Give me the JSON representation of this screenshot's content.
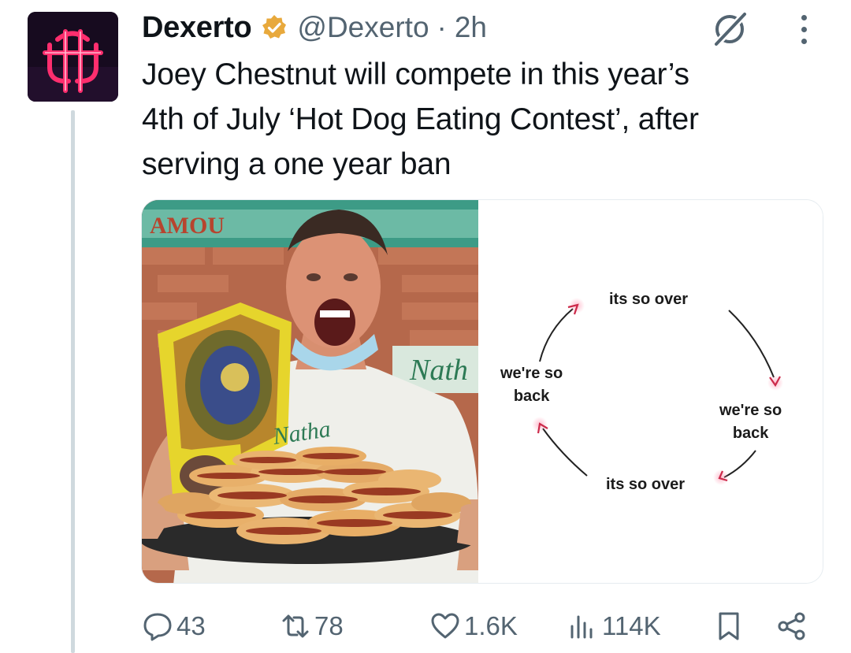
{
  "tweet": {
    "author_name": "Dexerto",
    "handle": "@Dexerto",
    "separator": "·",
    "time": "2h",
    "text_lines": [
      "Joey Chestnut will compete in this year’s",
      "4th of July ‘Hot Dog Eating Contest’, after",
      "serving a one year ban"
    ]
  },
  "meme": {
    "top": "its so over",
    "right_line1": "we're so",
    "right_line2": "back",
    "bottom": "its so over",
    "left_line1": "we're so",
    "left_line2": "back"
  },
  "actions": {
    "replies": "43",
    "reposts": "78",
    "likes": "1.6K",
    "views": "114K"
  },
  "colors": {
    "text": "#0f1419",
    "secondary": "#536471",
    "verified_badge": "#e8a93c",
    "thread_line": "#cfd9de",
    "avatar_neon": "#ff2e6e"
  },
  "icons": [
    "verified-badge-icon",
    "grok-icon",
    "more-icon",
    "reply-icon",
    "repost-icon",
    "like-icon",
    "views-icon",
    "bookmark-icon",
    "share-icon"
  ]
}
